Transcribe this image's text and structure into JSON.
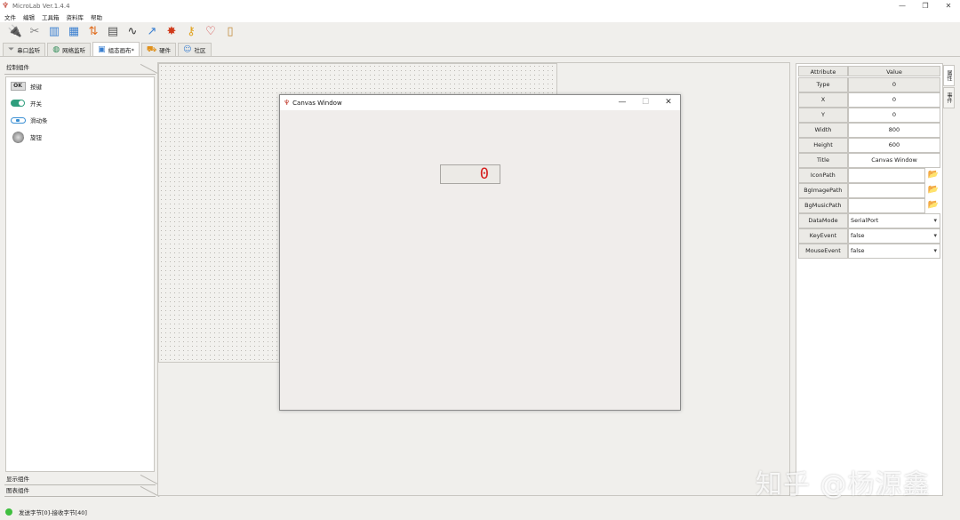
{
  "app": {
    "title": "MicroLab Ver.1.4.4",
    "icon": "app-logo-icon"
  },
  "window_controls": {
    "minimize": "—",
    "maximize": "❐",
    "close": "✕"
  },
  "menu": [
    "文件",
    "编辑",
    "工具箱",
    "资料库",
    "帮助"
  ],
  "toolbar": [
    {
      "icon": "connect-icon",
      "glyph": "🔌"
    },
    {
      "icon": "disconnect-icon",
      "glyph": "✂"
    },
    {
      "icon": "layout-icon",
      "glyph": "▥"
    },
    {
      "icon": "window-icon",
      "glyph": "▦"
    },
    {
      "icon": "transfer-icon",
      "glyph": "⇅"
    },
    {
      "icon": "calculator-icon",
      "glyph": "▤"
    },
    {
      "icon": "formula-icon",
      "glyph": "∿"
    },
    {
      "icon": "chart-icon",
      "glyph": "↗"
    },
    {
      "icon": "plugin-icon",
      "glyph": "✸"
    },
    {
      "icon": "key-icon",
      "glyph": "⚷"
    },
    {
      "icon": "heart-icon",
      "glyph": "♡"
    },
    {
      "icon": "book-icon",
      "glyph": "▯"
    }
  ],
  "tabs": [
    {
      "label": "串口监听",
      "icon": "filter-icon",
      "glyph": "⏷"
    },
    {
      "label": "网络监听",
      "icon": "globe-icon",
      "glyph": "◍"
    },
    {
      "label": "组态画布*",
      "icon": "canvas-icon",
      "glyph": "▣"
    },
    {
      "label": "硬件",
      "icon": "cart-icon",
      "glyph": "⛟"
    },
    {
      "label": "社区",
      "icon": "community-icon",
      "glyph": "☺"
    }
  ],
  "active_tab": 2,
  "left_panel": {
    "header": "控制组件",
    "items": [
      {
        "label": "按键",
        "icon": "ok-button-icon",
        "icon_text": "OK"
      },
      {
        "label": "开关",
        "icon": "switch-icon"
      },
      {
        "label": "滑动条",
        "icon": "slider-icon"
      },
      {
        "label": "旋钮",
        "icon": "knob-icon"
      }
    ],
    "bottom_groups": [
      "显示组件",
      "图表组件"
    ]
  },
  "canvas_window": {
    "title": "Canvas Window",
    "controls": {
      "minimize": "—",
      "maximize": "☐",
      "close": "✕"
    },
    "display_value": "0"
  },
  "properties": {
    "headers": {
      "attr": "Attribute",
      "value": "Value"
    },
    "rows": [
      {
        "attr": "Type",
        "value": "0",
        "kind": "readonly"
      },
      {
        "attr": "X",
        "value": "0",
        "kind": "text"
      },
      {
        "attr": "Y",
        "value": "0",
        "kind": "text"
      },
      {
        "attr": "Width",
        "value": "800",
        "kind": "text"
      },
      {
        "attr": "Height",
        "value": "600",
        "kind": "text"
      },
      {
        "attr": "Title",
        "value": "Canvas Window",
        "kind": "text"
      },
      {
        "attr": "IconPath",
        "value": "",
        "kind": "file"
      },
      {
        "attr": "BgImagePath",
        "value": "",
        "kind": "file"
      },
      {
        "attr": "BgMusicPath",
        "value": "",
        "kind": "file"
      },
      {
        "attr": "DataMode",
        "value": "SerialPort",
        "kind": "select"
      },
      {
        "attr": "KeyEvent",
        "value": "false",
        "kind": "select"
      },
      {
        "attr": "MouseEvent",
        "value": "false",
        "kind": "select"
      }
    ]
  },
  "side_tabs": [
    "属性",
    "事件"
  ],
  "status": {
    "text": "发送字节[0]-接收字节[40]",
    "color": "#3fbf3f"
  },
  "watermark": "知乎 @杨源鑫"
}
